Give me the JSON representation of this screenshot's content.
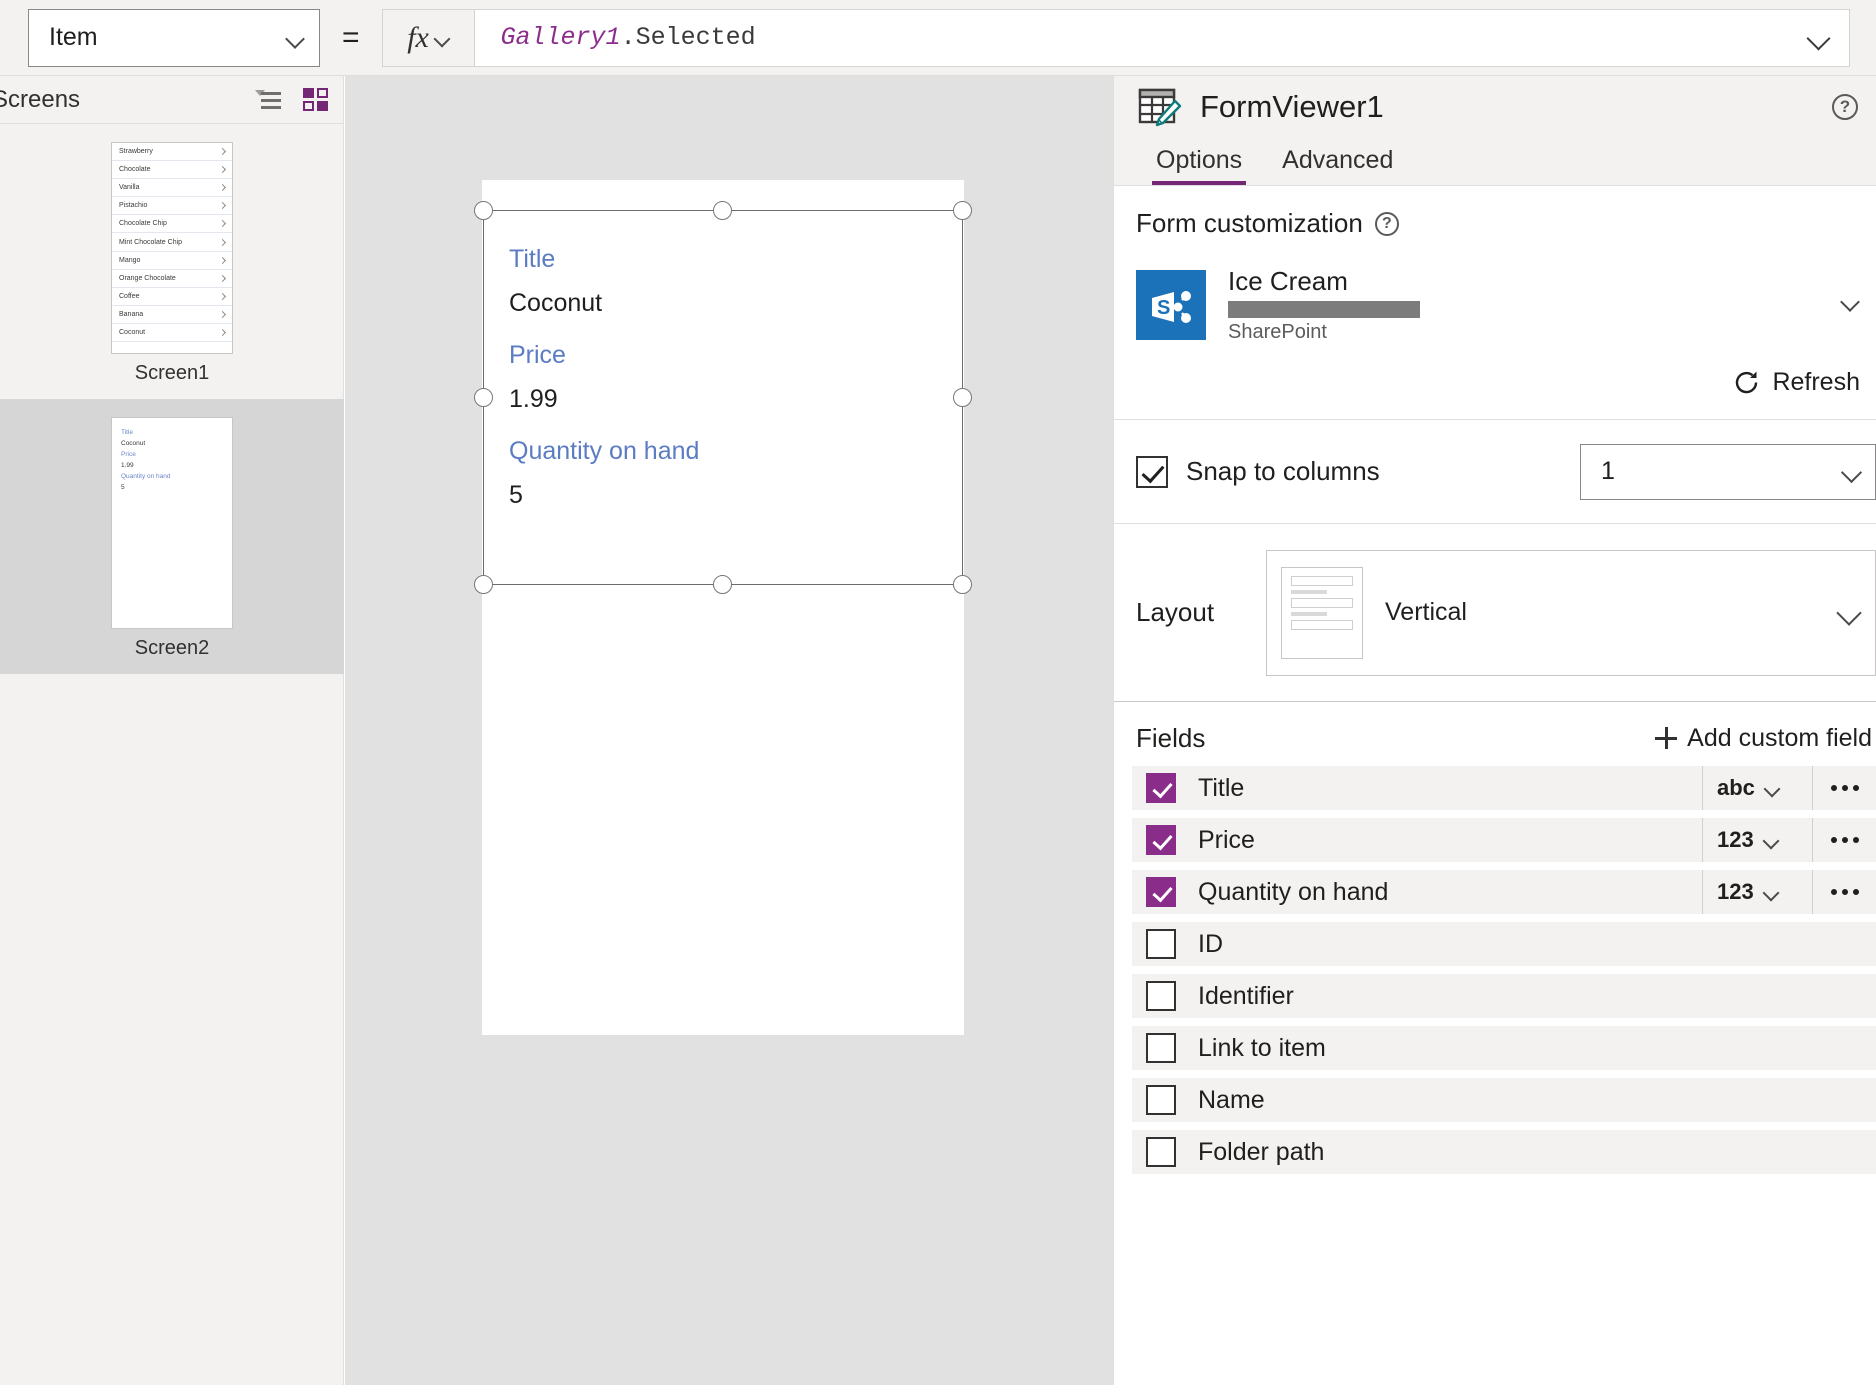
{
  "formula_bar": {
    "property_label": "Item",
    "equals": "=",
    "fx_label": "fx",
    "formula_identifier": "Gallery1",
    "formula_property": ".Selected"
  },
  "left_panel": {
    "title": "Screens",
    "screens": [
      {
        "label": "Screen1",
        "selected": false,
        "gallery_items": [
          "Strawberry",
          "Chocolate",
          "Vanilla",
          "Pistachio",
          "Chocolate Chip",
          "Mint Chocolate Chip",
          "Mango",
          "Orange Chocolate",
          "Coffee",
          "Banana",
          "Coconut"
        ]
      },
      {
        "label": "Screen2",
        "selected": true,
        "form_preview": [
          {
            "label": "Title",
            "value": "Coconut"
          },
          {
            "label": "Price",
            "value": "1.99"
          },
          {
            "label": "Quantity on hand",
            "value": "5"
          }
        ]
      }
    ]
  },
  "canvas": {
    "form_fields": [
      {
        "label": "Title",
        "value": "Coconut"
      },
      {
        "label": "Price",
        "value": "1.99"
      },
      {
        "label": "Quantity on hand",
        "value": "5"
      }
    ]
  },
  "right_panel": {
    "title": "FormViewer1",
    "tabs": [
      {
        "label": "Options",
        "active": true
      },
      {
        "label": "Advanced",
        "active": false
      }
    ],
    "form_customization": {
      "section_title": "Form customization",
      "data_source_name": "Ice Cream",
      "data_source_type": "SharePoint",
      "refresh_label": "Refresh"
    },
    "snap_to_columns": {
      "label": "Snap to columns",
      "checked": true,
      "columns_value": "1"
    },
    "layout": {
      "label": "Layout",
      "value": "Vertical"
    },
    "fields": {
      "title": "Fields",
      "add_custom_field_label": "Add custom field",
      "rows": [
        {
          "name": "Title",
          "checked": true,
          "type": "abc"
        },
        {
          "name": "Price",
          "checked": true,
          "type": "123"
        },
        {
          "name": "Quantity on hand",
          "checked": true,
          "type": "123"
        },
        {
          "name": "ID",
          "checked": false,
          "type": ""
        },
        {
          "name": "Identifier",
          "checked": false,
          "type": ""
        },
        {
          "name": "Link to item",
          "checked": false,
          "type": ""
        },
        {
          "name": "Name",
          "checked": false,
          "type": ""
        },
        {
          "name": "Folder path",
          "checked": false,
          "type": ""
        }
      ]
    }
  },
  "colors": {
    "accent_purple": "#742774",
    "form_label_blue": "#5b7cc3",
    "sharepoint_blue": "#1b72b8",
    "teal_pencil": "#0f7b7b"
  }
}
